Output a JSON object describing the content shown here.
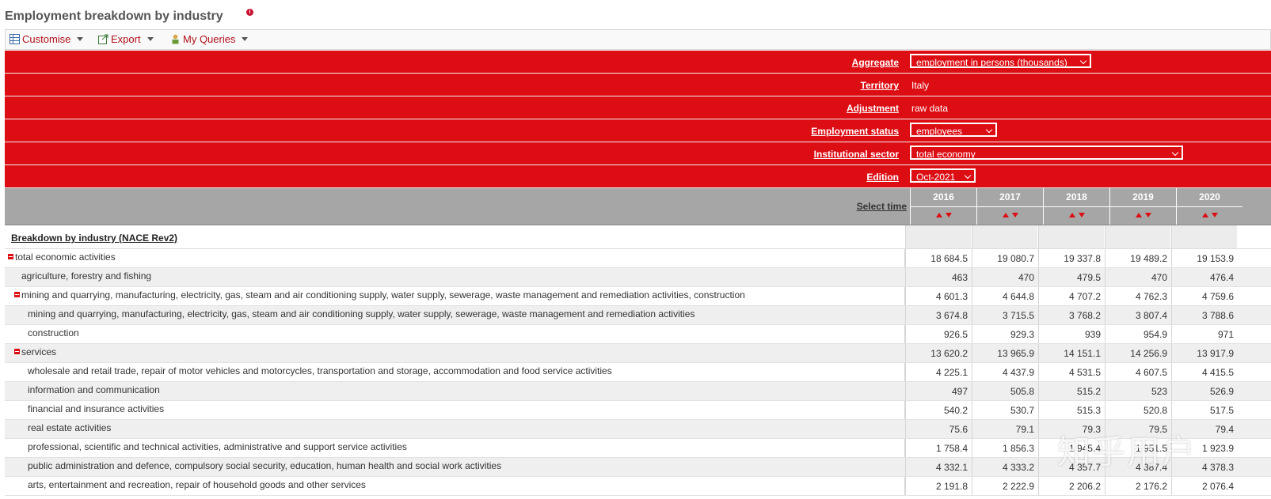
{
  "page": {
    "title": "Employment breakdown by industry"
  },
  "toolbar": {
    "customise": "Customise",
    "export": "Export",
    "my_queries": "My Queries"
  },
  "filters": [
    {
      "label": "Aggregate",
      "value": "employment in persons (thousands)",
      "type": "select"
    },
    {
      "label": "Territory",
      "value": "Italy",
      "type": "text"
    },
    {
      "label": "Adjustment",
      "value": "raw data",
      "type": "text"
    },
    {
      "label": "Employment status",
      "value": "employees",
      "type": "select"
    },
    {
      "label": "Institutional sector",
      "value": "total economy",
      "type": "select"
    },
    {
      "label": "Edition",
      "value": "Oct-2021",
      "type": "select"
    }
  ],
  "time": {
    "label": "Select time",
    "years": [
      "2016",
      "2017",
      "2018",
      "2019",
      "2020"
    ]
  },
  "table": {
    "header": "Breakdown by industry (NACE Rev2)",
    "rows": [
      {
        "label": "total economic activities",
        "level": 0,
        "collapsible": true,
        "values": [
          "18 684.5",
          "19 080.7",
          "19 337.8",
          "19 489.2",
          "19 153.9"
        ]
      },
      {
        "label": "agriculture, forestry and fishing",
        "level": 1,
        "collapsible": false,
        "values": [
          "463",
          "470",
          "479.5",
          "470",
          "476.4"
        ]
      },
      {
        "label": "mining and quarrying, manufacturing, electricity, gas, steam and air conditioning supply, water supply, sewerage, waste management and remediation activities, construction",
        "level": 1,
        "collapsible": true,
        "values": [
          "4 601.3",
          "4 644.8",
          "4 707.2",
          "4 762.3",
          "4 759.6"
        ]
      },
      {
        "label": "mining and quarrying, manufacturing, electricity, gas, steam and air conditioning supply, water supply, sewerage, waste management and remediation activities",
        "level": 2,
        "collapsible": false,
        "values": [
          "3 674.8",
          "3 715.5",
          "3 768.2",
          "3 807.4",
          "3 788.6"
        ]
      },
      {
        "label": "construction",
        "level": 2,
        "collapsible": false,
        "values": [
          "926.5",
          "929.3",
          "939",
          "954.9",
          "971"
        ]
      },
      {
        "label": "services",
        "level": 1,
        "collapsible": true,
        "values": [
          "13 620.2",
          "13 965.9",
          "14 151.1",
          "14 256.9",
          "13 917.9"
        ]
      },
      {
        "label": "wholesale and retail trade, repair of motor vehicles and motorcycles, transportation and storage, accommodation and food service activities",
        "level": 2,
        "collapsible": false,
        "values": [
          "4 225.1",
          "4 437.9",
          "4 531.5",
          "4 607.5",
          "4 415.5"
        ]
      },
      {
        "label": "information and communication",
        "level": 2,
        "collapsible": false,
        "values": [
          "497",
          "505.8",
          "515.2",
          "523",
          "526.9"
        ]
      },
      {
        "label": "financial and insurance activities",
        "level": 2,
        "collapsible": false,
        "values": [
          "540.2",
          "530.7",
          "515.3",
          "520.8",
          "517.5"
        ]
      },
      {
        "label": "real estate activities",
        "level": 2,
        "collapsible": false,
        "values": [
          "75.6",
          "79.1",
          "79.3",
          "79.5",
          "79.4"
        ]
      },
      {
        "label": "professional, scientific and technical activities, administrative and support service activities",
        "level": 2,
        "collapsible": false,
        "values": [
          "1 758.4",
          "1 856.3",
          "1 945.4",
          "1 951.5",
          "1 923.9"
        ]
      },
      {
        "label": "public administration and defence, compulsory social security, education, human health and social work activities",
        "level": 2,
        "collapsible": false,
        "values": [
          "4 332.1",
          "4 333.2",
          "4 357.7",
          "4 387.4",
          "4 378.3"
        ]
      },
      {
        "label": "arts, entertainment and recreation, repair of household goods and other services",
        "level": 2,
        "collapsible": false,
        "values": [
          "2 191.8",
          "2 222.9",
          "2 206.2",
          "2 176.2",
          "2 076.4"
        ]
      }
    ]
  },
  "watermark": "知乎用户",
  "colors": {
    "filter_bg": "#dd0d14",
    "time_bg": "#a6a6a6",
    "link": "#b0101a"
  }
}
